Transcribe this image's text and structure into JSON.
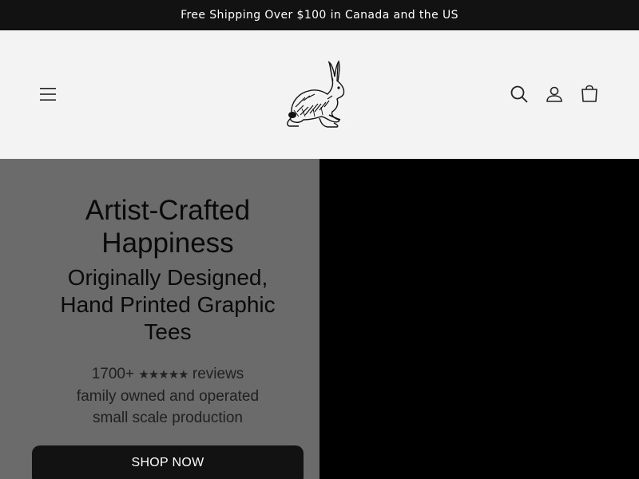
{
  "announcement": {
    "text": "Free Shipping Over $100 in Canada and the US"
  },
  "header": {
    "menu_icon": "hamburger-menu-icon",
    "logo": "rabbit-illustration-logo",
    "icons": [
      "search-icon",
      "account-icon",
      "cart-icon"
    ]
  },
  "hero": {
    "title_line1": "Artist-Crafted",
    "title_line2": "Happiness",
    "subtitle_line1": "Originally Designed,",
    "subtitle_line2": "Hand Printed Graphic",
    "subtitle_line3": "Tees",
    "reviews_count": "1700+",
    "reviews_stars": "★★★★★",
    "reviews_label": "reviews",
    "line2": "family owned and operated",
    "line3": "small scale production",
    "cta_label": "SHOP NOW"
  },
  "colors": {
    "announcement_bg": "#121212",
    "header_bg": "#f3f3f3",
    "hero_left_bg": "#6b6b6b",
    "hero_right_bg": "#000000",
    "button_bg": "#121212"
  }
}
